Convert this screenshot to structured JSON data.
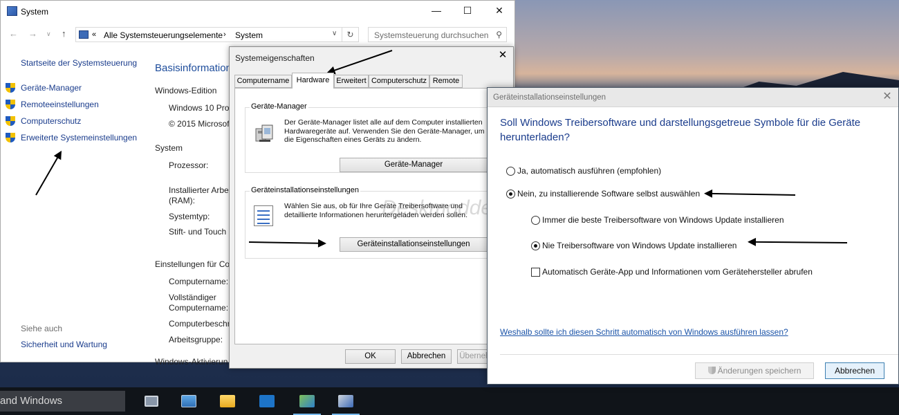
{
  "taskbar": {
    "search_text": "and Windows",
    "icons": [
      "task-view-icon",
      "this-pc-icon",
      "file-explorer-icon",
      "remote-app-icon",
      "control-panel-icon",
      "system-icon"
    ]
  },
  "system_window": {
    "title": "System",
    "address": {
      "chevrons": "«",
      "crumb1": "Alle Systemsteuerungselemente",
      "separator": "›",
      "crumb2": "System"
    },
    "search_placeholder": "Systemsteuerung durchsuchen",
    "sidebar": {
      "home": "Startseite der Systemsteuerung",
      "items": [
        "Geräte-Manager",
        "Remoteeinstellungen",
        "Computerschutz",
        "Erweiterte Systemeinstellungen"
      ],
      "see_also": "Siehe auch",
      "see_also_link": "Sicherheit und Wartung"
    },
    "main": {
      "title": "Basisinformation",
      "edition_head": "Windows-Edition",
      "edition_name": "Windows 10 Pro",
      "copyright": "© 2015 Microsof",
      "system_head": "System",
      "processor": "Prozessor:",
      "ram_line1": "Installierter Arbe",
      "ram_line2": "(RAM):",
      "systype": "Systemtyp:",
      "pen_touch": "Stift- und Touch",
      "settings_head": "Einstellungen für Co",
      "computer_name": "Computername:",
      "full_name_line1": "Vollständiger",
      "full_name_line2": "Computername:",
      "computer_desc": "Computerbeschr",
      "workgroup": "Arbeitsgruppe:",
      "activation_head": "Windows-Aktivierun"
    }
  },
  "props_dialog": {
    "title": "Systemeigenschaften",
    "tabs": [
      "Computername",
      "Hardware",
      "Erweitert",
      "Computerschutz",
      "Remote"
    ],
    "selected_tab": "Hardware",
    "devmgr_group": {
      "label": "Geräte-Manager",
      "text": "Der Geräte-Manager listet alle auf dem Computer installierten Hardwaregeräte auf. Verwenden Sie den Geräte-Manager, um die Eigenschaften eines Geräts zu ändern.",
      "button": "Geräte-Manager"
    },
    "devset_group": {
      "label": "Geräteinstallationseinstellungen",
      "text": "Wählen Sie aus, ob für Ihre Geräte Treibersoftware und detaillierte Informationen heruntergeladen werden sollen.",
      "button": "Geräteinstallationseinstellungen"
    },
    "ok": "OK",
    "cancel": "Abbrechen",
    "apply": "Übernehmen"
  },
  "gi_dialog": {
    "title": "Geräteinstallationseinstellungen",
    "question": "Soll Windows Treibersoftware und darstellungsgetreue Symbole für die Geräte herunterladen?",
    "opt_yes": "Ja, automatisch ausführen (empfohlen)",
    "opt_no": "Nein, zu installierende Software selbst auswählen",
    "sub_best": "Immer die beste Treibersoftware von Windows Update installieren",
    "sub_never": "Nie Treibersoftware von Windows Update installieren",
    "sub_app": "Automatisch Geräte-App und Informationen vom Gerätehersteller abrufen",
    "link": "Weshalb sollte ich diesen Schritt automatisch von Windows ausführen lassen?",
    "save": "Änderungen speichern",
    "cancel": "Abbrechen",
    "state": {
      "no_selected": true,
      "never_selected": true,
      "app_checked": false
    }
  },
  "watermark": "Deskmodder.de",
  "colors": {
    "link_blue": "#1a3c8c",
    "heading_blue": "#1d4c9b",
    "taskbar": "#101419",
    "accent": "#76b9ed"
  }
}
